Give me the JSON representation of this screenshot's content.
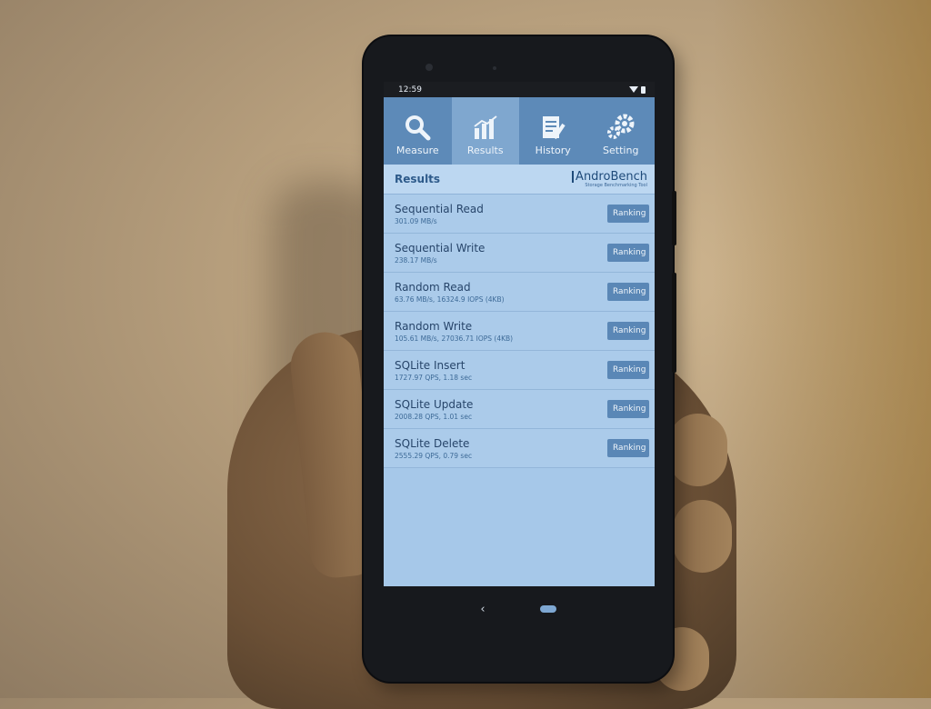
{
  "status_bar": {
    "time": "12:59"
  },
  "tabs": [
    {
      "label": "Measure",
      "icon": "magnifier-icon"
    },
    {
      "label": "Results",
      "icon": "bar-chart-icon"
    },
    {
      "label": "History",
      "icon": "document-pencil-icon"
    },
    {
      "label": "Setting",
      "icon": "gears-icon"
    }
  ],
  "active_tab": "Results",
  "header": {
    "title": "Results",
    "logo_main": "AndroBench",
    "logo_sub": "Storage Benchmarking Tool"
  },
  "results": [
    {
      "name": "Sequential Read",
      "value": "301.09 MB/s",
      "button": "Ranking"
    },
    {
      "name": "Sequential Write",
      "value": "238.17 MB/s",
      "button": "Ranking"
    },
    {
      "name": "Random Read",
      "value": "63.76 MB/s, 16324.9 IOPS (4KB)",
      "button": "Ranking"
    },
    {
      "name": "Random Write",
      "value": "105.61 MB/s, 27036.71 IOPS (4KB)",
      "button": "Ranking"
    },
    {
      "name": "SQLite Insert",
      "value": "1727.97 QPS, 1.18 sec",
      "button": "Ranking"
    },
    {
      "name": "SQLite Update",
      "value": "2008.28 QPS, 1.01 sec",
      "button": "Ranking"
    },
    {
      "name": "SQLite Delete",
      "value": "2555.29 QPS, 0.79 sec",
      "button": "Ranking"
    }
  ],
  "nav": {
    "back_glyph": "‹"
  },
  "colors": {
    "tab_bar": "#5d8ab8",
    "active_tab": "#7fa7cf",
    "screen_bg": "#a6c8e9",
    "button": "#5a87b6"
  }
}
